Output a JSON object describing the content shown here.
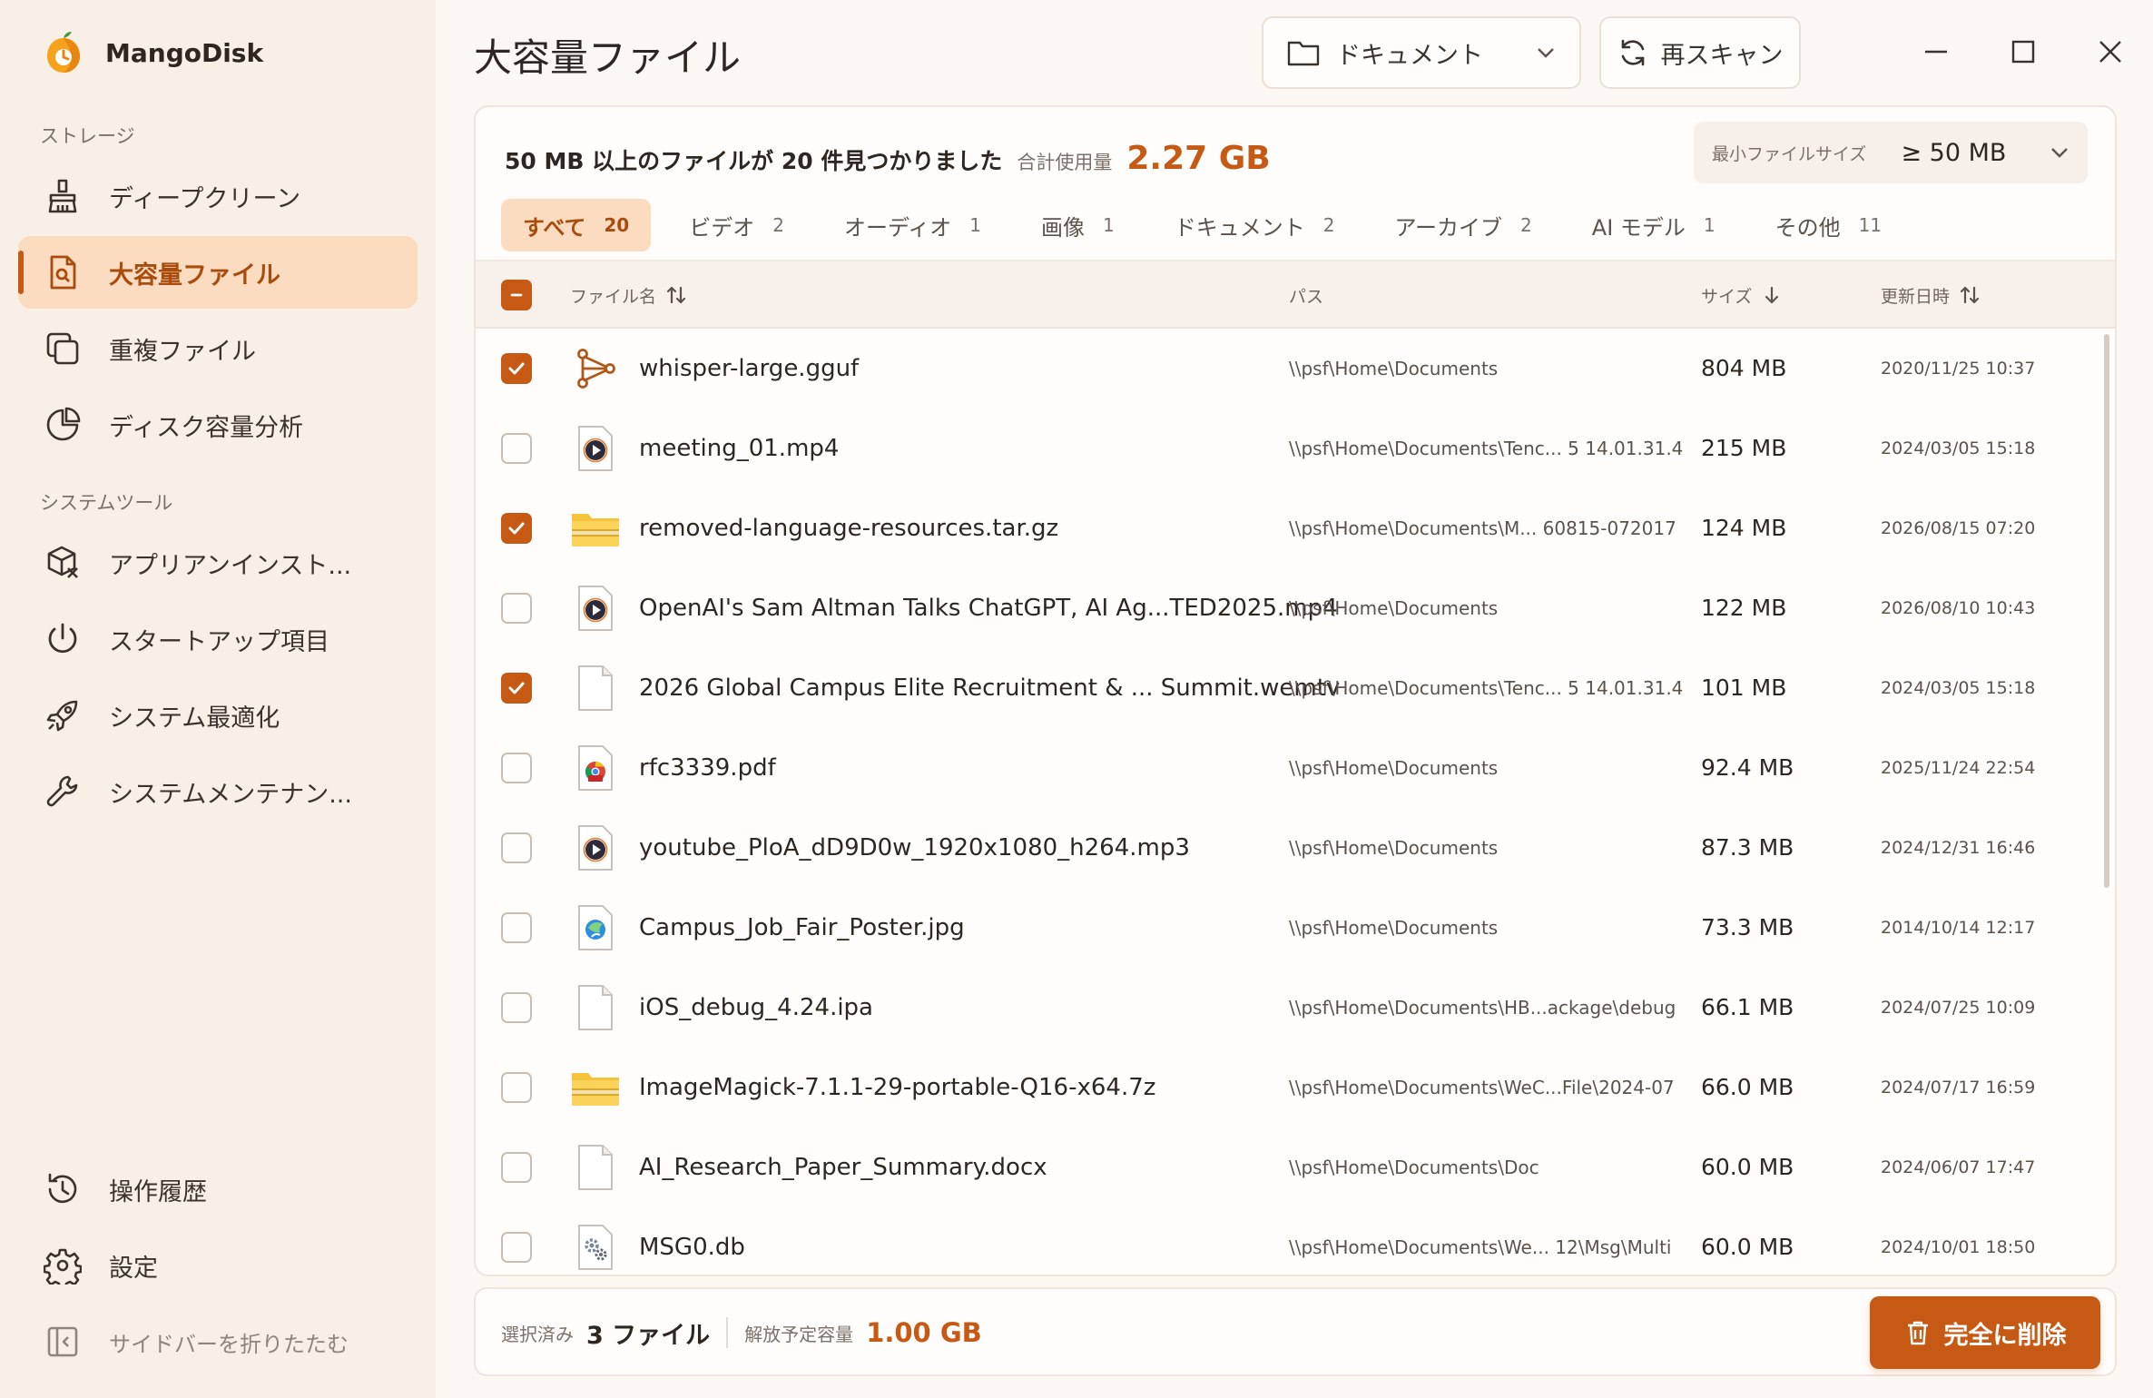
{
  "app": {
    "name": "MangoDisk"
  },
  "sidebar": {
    "storage_title": "ストレージ",
    "storage_items": [
      {
        "label": "ディープクリーン",
        "icon": "broom-icon"
      },
      {
        "label": "大容量ファイル",
        "icon": "large-file-icon",
        "active": true
      },
      {
        "label": "重複ファイル",
        "icon": "duplicate-icon"
      },
      {
        "label": "ディスク容量分析",
        "icon": "pie-chart-icon"
      }
    ],
    "tools_title": "システムツール",
    "tools_items": [
      {
        "label": "アプリアンインスト...",
        "icon": "uninstall-icon"
      },
      {
        "label": "スタートアップ項目",
        "icon": "power-icon"
      },
      {
        "label": "システム最適化",
        "icon": "rocket-icon"
      },
      {
        "label": "システムメンテナン...",
        "icon": "wrench-icon"
      }
    ],
    "bottom_items": [
      {
        "label": "操作履歴",
        "icon": "history-icon"
      },
      {
        "label": "設定",
        "icon": "gear-icon"
      }
    ],
    "collapse_label": "サイドバーを折りたたむ"
  },
  "header": {
    "title": "大容量ファイル",
    "folder_select": "ドキュメント",
    "rescan_label": "再スキャン"
  },
  "summary": {
    "found_text": "50 MB 以上のファイルが 20 件見つかりました",
    "total_label": "合計使用量",
    "total_value": "2.27 GB",
    "min_size_label": "最小ファイルサイズ",
    "min_size_value": "≥ 50 MB"
  },
  "tabs": [
    {
      "label": "すべて",
      "count": "20",
      "active": true
    },
    {
      "label": "ビデオ",
      "count": "2"
    },
    {
      "label": "オーディオ",
      "count": "1"
    },
    {
      "label": "画像",
      "count": "1"
    },
    {
      "label": "ドキュメント",
      "count": "2"
    },
    {
      "label": "アーカイブ",
      "count": "2"
    },
    {
      "label": "AI モデル",
      "count": "1"
    },
    {
      "label": "その他",
      "count": "11"
    }
  ],
  "table": {
    "columns": {
      "name": "ファイル名",
      "path": "パス",
      "size": "サイズ",
      "date": "更新日時"
    },
    "rows": [
      {
        "checked": true,
        "icon": "model-icon",
        "name": "whisper-large.gguf",
        "path": "\\\\psf\\Home\\Documents",
        "size": "804 MB",
        "date": "2020/11/25 10:37"
      },
      {
        "checked": false,
        "icon": "video-icon",
        "name": "meeting_01.mp4",
        "path": "\\\\psf\\Home\\Documents\\Tenc... 5 14.01.31.4",
        "size": "215 MB",
        "date": "2024/03/05 15:18"
      },
      {
        "checked": true,
        "icon": "archive-icon",
        "name": "removed-language-resources.tar.gz",
        "path": "\\\\psf\\Home\\Documents\\M... 60815-072017",
        "size": "124 MB",
        "date": "2026/08/15 07:20"
      },
      {
        "checked": false,
        "icon": "video-icon",
        "name": "OpenAI's Sam Altman Talks ChatGPT, AI Ag...TED2025.mp4",
        "path": "\\\\psf\\Home\\Documents",
        "size": "122 MB",
        "date": "2026/08/10 10:43"
      },
      {
        "checked": true,
        "icon": "file-icon",
        "name": "2026 Global Campus Elite Recruitment & ... Summit.wemtv",
        "path": "\\\\psf\\Home\\Documents\\Tenc... 5 14.01.31.4",
        "size": "101 MB",
        "date": "2024/03/05 15:18"
      },
      {
        "checked": false,
        "icon": "pdf-icon",
        "name": "rfc3339.pdf",
        "path": "\\\\psf\\Home\\Documents",
        "size": "92.4 MB",
        "date": "2025/11/24 22:54"
      },
      {
        "checked": false,
        "icon": "audio-icon",
        "name": "youtube_PloA_dD9D0w_1920x1080_h264.mp3",
        "path": "\\\\psf\\Home\\Documents",
        "size": "87.3 MB",
        "date": "2024/12/31 16:46"
      },
      {
        "checked": false,
        "icon": "image-icon",
        "name": "Campus_Job_Fair_Poster.jpg",
        "path": "\\\\psf\\Home\\Documents",
        "size": "73.3 MB",
        "date": "2014/10/14 12:17"
      },
      {
        "checked": false,
        "icon": "file-icon",
        "name": "iOS_debug_4.24.ipa",
        "path": "\\\\psf\\Home\\Documents\\HB...ackage\\debug",
        "size": "66.1 MB",
        "date": "2024/07/25 10:09"
      },
      {
        "checked": false,
        "icon": "archive-icon",
        "name": "ImageMagick-7.1.1-29-portable-Q16-x64.7z",
        "path": "\\\\psf\\Home\\Documents\\WeC...File\\2024-07",
        "size": "66.0 MB",
        "date": "2024/07/17 16:59"
      },
      {
        "checked": false,
        "icon": "file-icon",
        "name": "AI_Research_Paper_Summary.docx",
        "path": "\\\\psf\\Home\\Documents\\Doc",
        "size": "60.0 MB",
        "date": "2024/06/07 17:47"
      },
      {
        "checked": false,
        "icon": "settings-file-icon",
        "name": "MSG0.db",
        "path": "\\\\psf\\Home\\Documents\\We... 12\\Msg\\Multi",
        "size": "60.0 MB",
        "date": "2024/10/01 18:50"
      }
    ]
  },
  "footer": {
    "selected_label": "選択済み",
    "selected_value": "3 ファイル",
    "free_label": "解放予定容量",
    "free_value": "1.00 GB",
    "delete_label": "完全に削除"
  },
  "colors": {
    "accent": "#c65a14",
    "accent_bg": "#fcdcc0",
    "sidebar_bg": "#f8efe6"
  }
}
